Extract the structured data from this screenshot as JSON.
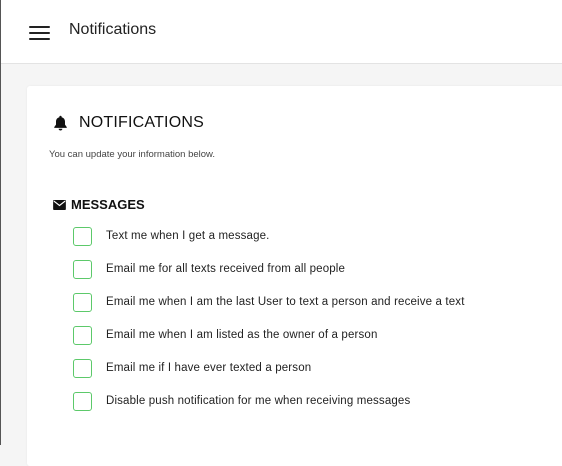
{
  "header": {
    "title": "Notifications",
    "menu_icon": "hamburger-menu-icon"
  },
  "notifications": {
    "title": "NOTIFICATIONS",
    "title_icon": "bell-icon",
    "subtitle": "You can update your information below.",
    "messages": {
      "title": "MESSAGES",
      "title_icon": "envelope-icon",
      "options": [
        {
          "label": "Text me when I get a message.",
          "checked": false
        },
        {
          "label": "Email me for all texts received from all people",
          "checked": false
        },
        {
          "label": "Email me when I am the last User to text a person and receive a text",
          "checked": false
        },
        {
          "label": "Email me when I am listed as the owner of a person",
          "checked": false
        },
        {
          "label": "Email me if I have ever texted a person",
          "checked": false
        },
        {
          "label": "Disable push notification for me when receiving messages",
          "checked": false
        }
      ]
    }
  },
  "colors": {
    "checkbox_border": "#5cc96a",
    "background": "#f5f5f5",
    "card": "#ffffff"
  }
}
